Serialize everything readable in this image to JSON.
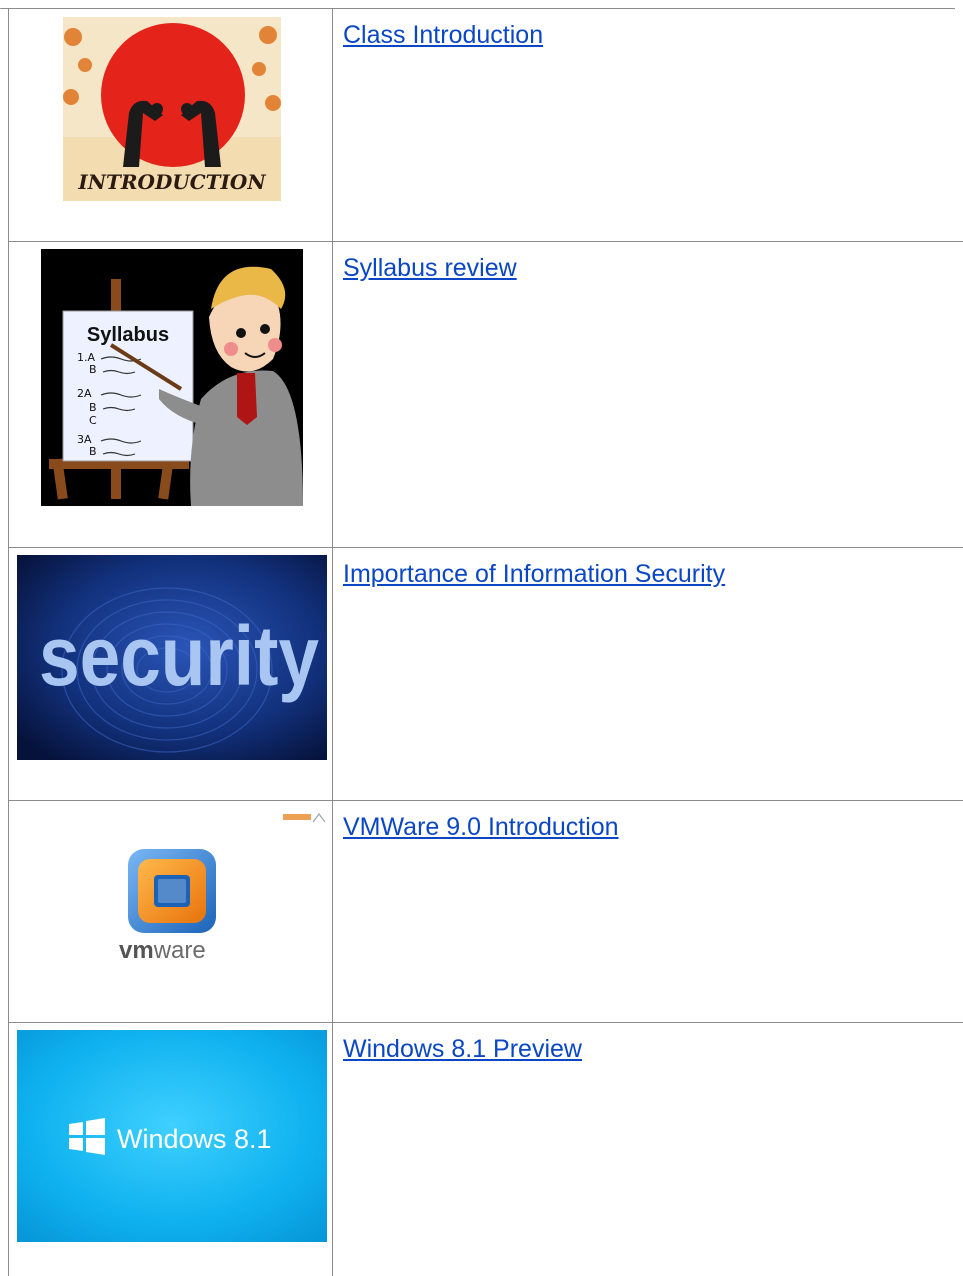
{
  "rows": [
    {
      "link": "Class Introduction",
      "image": {
        "caption": "INTRODUCTION",
        "icon": "introduction-image"
      }
    },
    {
      "link": "Syllabus review",
      "image": {
        "caption": "Syllabus",
        "lines": [
          "1.A",
          "B",
          "2A",
          "B",
          "C",
          "3A",
          "B"
        ],
        "icon": "syllabus-image"
      }
    },
    {
      "link": "Importance of Information Security",
      "image": {
        "caption": "security",
        "icon": "security-image"
      }
    },
    {
      "link": "VMWare 9.0 Introduction",
      "image": {
        "caption_bold": "vm",
        "caption_light": "ware",
        "icon": "vmware-logo-image"
      }
    },
    {
      "link": "Windows 8.1 Preview",
      "image": {
        "caption": "Windows 8.1",
        "icon": "windows-logo-image"
      }
    }
  ],
  "colors": {
    "link": "#0b47c5",
    "border": "#8c8c8c",
    "intro_sun": "#e4231b",
    "security_bg": "#0d1f56",
    "vmware_orange": "#f39c12",
    "vmware_blue": "#3b8ad9",
    "windows_blue": "#0aa6e6"
  }
}
